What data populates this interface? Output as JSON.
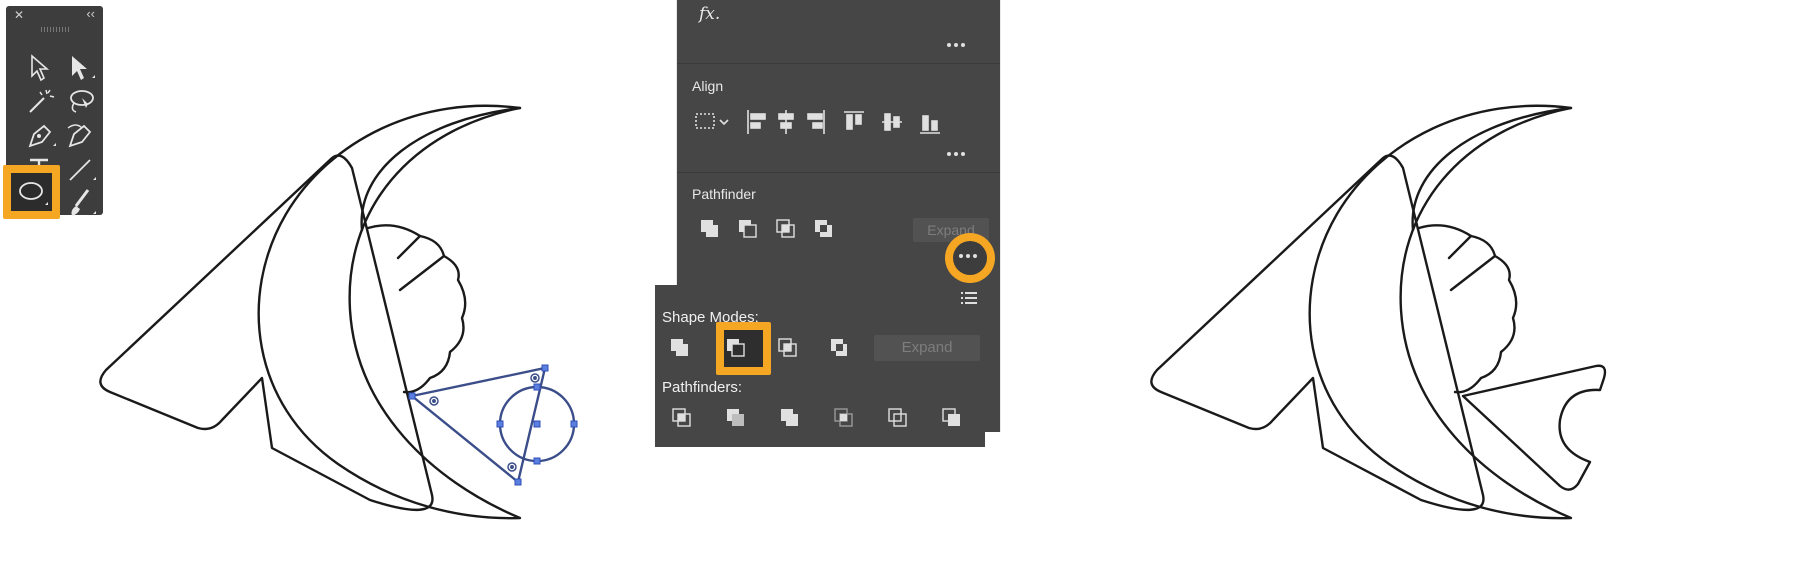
{
  "toolbox": {
    "close_glyph": "✕",
    "collapse_glyph": "‹‹",
    "tools": [
      "selection-tool",
      "direct-selection-tool",
      "magic-wand-tool",
      "lasso-tool",
      "pen-tool",
      "curvature-tool",
      "type-tool",
      "line-segment-tool",
      "ellipse-tool",
      "paintbrush-tool"
    ],
    "active_tool": "ellipse-tool"
  },
  "properties": {
    "fx_label": "fx.",
    "align_title": "Align",
    "pathfinder_title": "Pathfinder",
    "expand_label": "Expand"
  },
  "pathfinder_popup": {
    "shape_modes_label": "Shape Modes:",
    "pathfinders_label": "Pathfinders:",
    "expand_label": "Expand",
    "shape_modes": [
      "unite",
      "minus-front",
      "intersect",
      "exclude"
    ],
    "active_mode": "minus-front",
    "pathfinders": [
      "divide",
      "trim",
      "merge",
      "crop",
      "outline",
      "minus-back"
    ]
  },
  "colors": {
    "highlight": "#f5a623",
    "panel": "#464646",
    "selection": "#3e5fd6"
  }
}
